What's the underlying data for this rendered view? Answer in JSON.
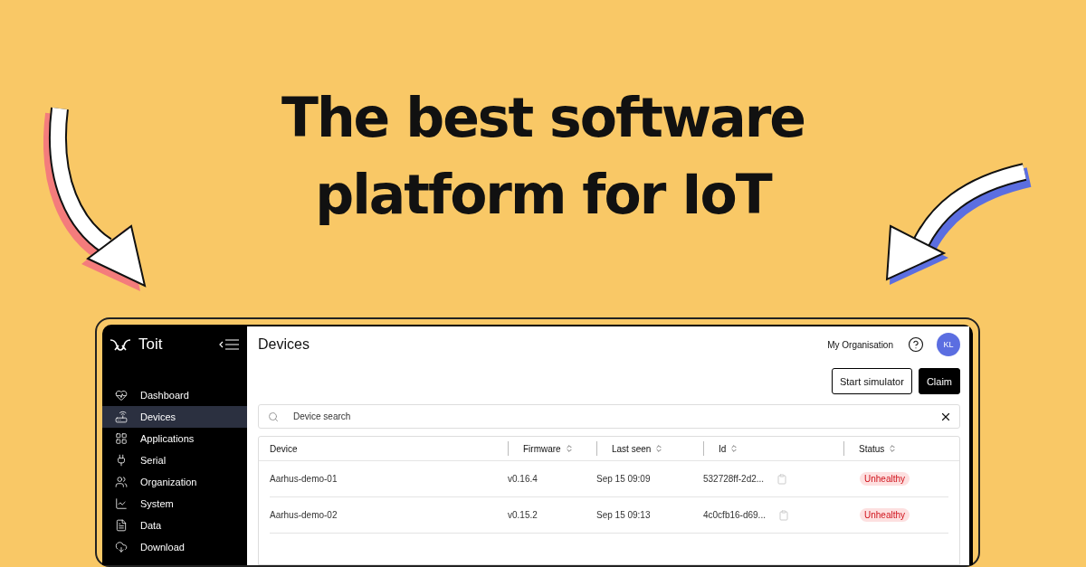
{
  "headline": [
    "The best software",
    "platform for IoT"
  ],
  "app": {
    "brand": "Toit",
    "sidebar": {
      "items": [
        {
          "label": "Dashboard",
          "selected": false
        },
        {
          "label": "Devices",
          "selected": true
        },
        {
          "label": "Applications",
          "selected": false
        },
        {
          "label": "Serial",
          "selected": false
        },
        {
          "label": "Organization",
          "selected": false
        },
        {
          "label": "System",
          "selected": false
        },
        {
          "label": "Data",
          "selected": false
        },
        {
          "label": "Download",
          "selected": false
        }
      ]
    },
    "page_title": "Devices",
    "organisation": "My Organisation",
    "avatar": "KL",
    "buttons": [
      {
        "label": "Start simulator",
        "kind": "outline"
      },
      {
        "label": "Claim",
        "kind": "primary"
      }
    ],
    "search": {
      "placeholder": "Device search"
    },
    "table": {
      "columns": [
        {
          "label": "Device",
          "sortable": false
        },
        {
          "label": "Firmware",
          "sortable": true
        },
        {
          "label": "Last seen",
          "sortable": true
        },
        {
          "label": "Id",
          "sortable": true
        },
        {
          "label": "Status",
          "sortable": true
        }
      ],
      "rows": [
        {
          "device": "Aarhus-demo-01",
          "firmware": "v0.16.4",
          "last_seen": "Sep 15 09:09",
          "id": "532728ff-2d2...",
          "status": {
            "label": "Unhealthy",
            "kind": "unhealthy"
          }
        },
        {
          "device": "Aarhus-demo-02",
          "firmware": "v0.15.2",
          "last_seen": "Sep 15 09:13",
          "id": "4c0cfb16-d69...",
          "status": {
            "label": "Unhealthy",
            "kind": "unhealthy"
          }
        }
      ]
    }
  }
}
